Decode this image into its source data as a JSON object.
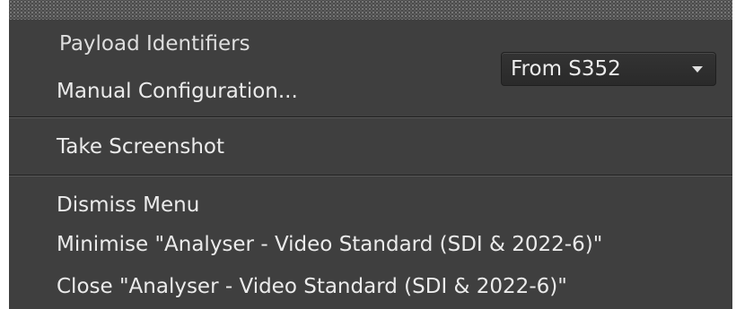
{
  "menu": {
    "payload_identifiers": {
      "label": "Payload Identifiers",
      "selected_value": "From S352"
    },
    "manual_configuration": "Manual Configuration...",
    "take_screenshot": "Take Screenshot",
    "dismiss_menu": "Dismiss Menu",
    "minimise": "Minimise \"Analyser - Video Standard (SDI & 2022-6)\"",
    "close": "Close \"Analyser - Video Standard (SDI & 2022-6)\""
  },
  "colors": {
    "menu_background": "#3f3f3f",
    "text": "#ebebeb",
    "select_background": "#2e2e2e",
    "divider": "#202020"
  },
  "icons": {
    "select_arrow": "chevron-down-icon"
  }
}
